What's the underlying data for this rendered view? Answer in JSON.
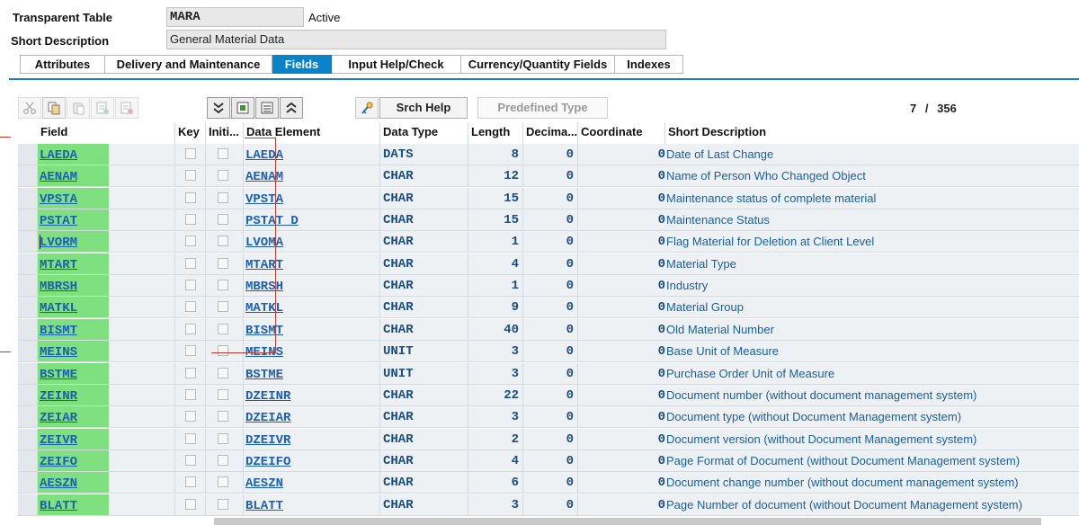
{
  "header": {
    "table_label": "Transparent Table",
    "table_value": "MARA",
    "status": "Active",
    "desc_label": "Short Description",
    "desc_value": "General Material Data"
  },
  "tabs": [
    {
      "label": "Attributes",
      "active": false
    },
    {
      "label": "Delivery and Maintenance",
      "active": false
    },
    {
      "label": "Fields",
      "active": true
    },
    {
      "label": "Input Help/Check",
      "active": false
    },
    {
      "label": "Currency/Quantity Fields",
      "active": false
    },
    {
      "label": "Indexes",
      "active": false
    }
  ],
  "toolbar": {
    "icons": [
      "cut-icon",
      "copy-icon",
      "paste-icon",
      "insert-row-icon",
      "delete-row-icon",
      "expand-all-icon",
      "new-row-icon",
      "select-block-icon",
      "collapse-all-icon",
      "key-icon"
    ],
    "srch_help_label": "Srch Help",
    "predefined_type_label": "Predefined Type",
    "counter_current": "7",
    "counter_sep": "/",
    "counter_total": "356"
  },
  "columns": [
    "Field",
    "Key",
    "Initi...",
    "Data Element",
    "Data Type",
    "Length",
    "Decima...",
    "Coordinate",
    "Short Description"
  ],
  "rows": [
    {
      "field": "LAEDA",
      "data_element": "LAEDA",
      "data_type": "DATS",
      "length": "8",
      "decimals": "0",
      "coordinate": "0",
      "short_description": "Date of Last Change"
    },
    {
      "field": "AENAM",
      "data_element": "AENAM",
      "data_type": "CHAR",
      "length": "12",
      "decimals": "0",
      "coordinate": "0",
      "short_description": "Name of Person Who Changed Object"
    },
    {
      "field": "VPSTA",
      "data_element": "VPSTA",
      "data_type": "CHAR",
      "length": "15",
      "decimals": "0",
      "coordinate": "0",
      "short_description": "Maintenance status of complete material"
    },
    {
      "field": "PSTAT",
      "data_element": "PSTAT_D",
      "data_type": "CHAR",
      "length": "15",
      "decimals": "0",
      "coordinate": "0",
      "short_description": "Maintenance Status"
    },
    {
      "field": "LVORM",
      "data_element": "LVOMA",
      "data_type": "CHAR",
      "length": "1",
      "decimals": "0",
      "coordinate": "0",
      "short_description": "Flag Material for Deletion at Client Level"
    },
    {
      "field": "MTART",
      "data_element": "MTART",
      "data_type": "CHAR",
      "length": "4",
      "decimals": "0",
      "coordinate": "0",
      "short_description": "Material Type"
    },
    {
      "field": "MBRSH",
      "data_element": "MBRSH",
      "data_type": "CHAR",
      "length": "1",
      "decimals": "0",
      "coordinate": "0",
      "short_description": "Industry"
    },
    {
      "field": "MATKL",
      "data_element": "MATKL",
      "data_type": "CHAR",
      "length": "9",
      "decimals": "0",
      "coordinate": "0",
      "short_description": "Material Group"
    },
    {
      "field": "BISMT",
      "data_element": "BISMT",
      "data_type": "CHAR",
      "length": "40",
      "decimals": "0",
      "coordinate": "0",
      "short_description": "Old Material Number"
    },
    {
      "field": "MEINS",
      "data_element": "MEINS",
      "data_type": "UNIT",
      "length": "3",
      "decimals": "0",
      "coordinate": "0",
      "short_description": "Base Unit of Measure"
    },
    {
      "field": "BSTME",
      "data_element": "BSTME",
      "data_type": "UNIT",
      "length": "3",
      "decimals": "0",
      "coordinate": "0",
      "short_description": "Purchase Order Unit of Measure"
    },
    {
      "field": "ZEINR",
      "data_element": "DZEINR",
      "data_type": "CHAR",
      "length": "22",
      "decimals": "0",
      "coordinate": "0",
      "short_description": "Document number (without document management system)"
    },
    {
      "field": "ZEIAR",
      "data_element": "DZEIAR",
      "data_type": "CHAR",
      "length": "3",
      "decimals": "0",
      "coordinate": "0",
      "short_description": "Document type (without Document Management system)"
    },
    {
      "field": "ZEIVR",
      "data_element": "DZEIVR",
      "data_type": "CHAR",
      "length": "2",
      "decimals": "0",
      "coordinate": "0",
      "short_description": "Document version (without Document Management system)"
    },
    {
      "field": "ZEIFO",
      "data_element": "DZEIFO",
      "data_type": "CHAR",
      "length": "4",
      "decimals": "0",
      "coordinate": "0",
      "short_description": "Page Format of Document (without Document Management system)"
    },
    {
      "field": "AESZN",
      "data_element": "AESZN",
      "data_type": "CHAR",
      "length": "6",
      "decimals": "0",
      "coordinate": "0",
      "short_description": "Document change number (without document management system)"
    },
    {
      "field": "BLATT",
      "data_element": "BLATT",
      "data_type": "CHAR",
      "length": "3",
      "decimals": "0",
      "coordinate": "0",
      "short_description": "Page Number of document (without Document Management system)"
    }
  ],
  "colors": {
    "accent": "#0a82c8",
    "field_highlight": "#7ee07e",
    "link": "#1a5fb4",
    "grid_row": "#eef1f4"
  }
}
